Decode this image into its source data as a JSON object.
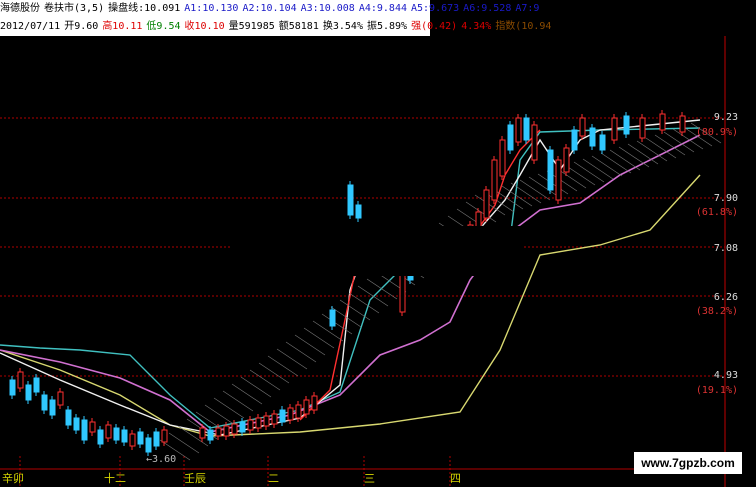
{
  "header": {
    "line1": [
      {
        "text": "海德股份",
        "color": "black"
      },
      {
        "text": "卷扶市(3,5)",
        "color": "black"
      },
      {
        "text": "操盘线:10.091",
        "color": "black"
      },
      {
        "text": "A1:10.130",
        "color": "blue"
      },
      {
        "text": "A2:10.104",
        "color": "blue"
      },
      {
        "text": "A3:10.008",
        "color": "blue"
      },
      {
        "text": "A4:9.844",
        "color": "blue"
      },
      {
        "text": "A5:9.673",
        "color": "blue"
      },
      {
        "text": "A6:9.528",
        "color": "blue"
      },
      {
        "text": "A7:9",
        "color": "blue"
      }
    ],
    "line2": [
      {
        "text": "2012/07/11",
        "color": "black"
      },
      {
        "text": "开9.60",
        "color": "black"
      },
      {
        "text": "高10.11",
        "color": "red"
      },
      {
        "text": "低9.54",
        "color": "green"
      },
      {
        "text": "收10.10",
        "color": "red"
      },
      {
        "text": "量591985",
        "color": "black"
      },
      {
        "text": "额58181",
        "color": "black"
      },
      {
        "text": "换3.54%",
        "color": "black"
      },
      {
        "text": "振5.89%",
        "color": "black"
      },
      {
        "text": "强(0.42)",
        "color": "red"
      },
      {
        "text": "4.34%",
        "color": "red"
      },
      {
        "text": "指数(10.94",
        "color": "brown"
      }
    ]
  },
  "price_axis": [
    {
      "price": "9.23",
      "pct": "(80.9%)"
    },
    {
      "price": "7.90",
      "pct": "(61.8%)"
    },
    {
      "price": "7.08",
      "pct": ""
    },
    {
      "price": "6.26",
      "pct": "(38.2%)"
    },
    {
      "price": "4.93",
      "pct": "(19.1%)"
    }
  ],
  "low_marker": "3.60",
  "months": [
    "辛卯",
    "十二",
    "壬辰",
    "二",
    "三",
    "四"
  ],
  "watermark": "www.7gpzb.com",
  "colors": {
    "up": "#ff3030",
    "down": "#30c8ff",
    "guide": "#c00000",
    "axis": "#c00000"
  }
}
